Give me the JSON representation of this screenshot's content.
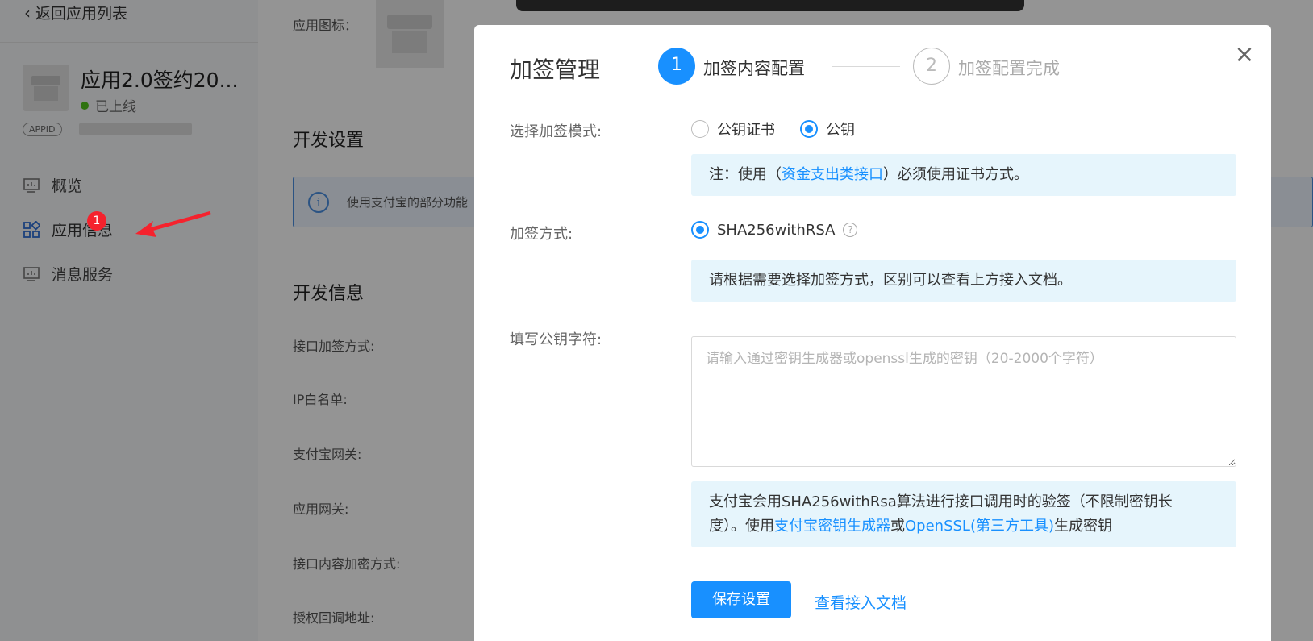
{
  "sidebar": {
    "back_label": "返回应用列表",
    "app_name": "应用2.0签约20...",
    "app_status": "已上线",
    "appid_tag": "APPID",
    "nav": [
      {
        "label": "概览",
        "icon": "monitor-chart-icon"
      },
      {
        "label": "应用信息",
        "icon": "grid-apps-icon"
      },
      {
        "label": "消息服务",
        "icon": "monitor-chart-icon"
      }
    ],
    "badge_count": "1"
  },
  "main": {
    "app_icon_label": "应用图标：",
    "dev_settings_title": "开发设置",
    "info_bar_text": "使用支付宝的部分功能",
    "dev_info_title": "开发信息",
    "fields": [
      "接口加签方式:",
      "IP白名单:",
      "支付宝网关:",
      "应用网关:",
      "接口内容加密方式:",
      "授权回调地址:"
    ]
  },
  "modal": {
    "title": "加签管理",
    "steps": [
      {
        "number": "1",
        "label": "加签内容配置"
      },
      {
        "number": "2",
        "label": "加签配置完成"
      }
    ],
    "close_symbol": "×",
    "mode_label": "选择加签模式:",
    "mode_options": [
      "公钥证书",
      "公钥"
    ],
    "mode_selected": "公钥",
    "mode_note_prefix": "注：使用（",
    "mode_note_link": "资金支出类接口",
    "mode_note_suffix": "）必须使用证书方式。",
    "method_label": "加签方式:",
    "method_option": "SHA256withRSA",
    "method_note": "请根据需要选择加签方式，区别可以查看上方接入文档。",
    "key_label": "填写公钥字符:",
    "key_placeholder": "请输入通过密钥生成器或openssl生成的密钥（20-2000个字符）",
    "tip_line1": "支付宝会用SHA256withRsa算法进行接口调用时的验签（不限制密钥长",
    "tip_line2_prefix": "度）。使用",
    "tip_link1": "支付宝密钥生成器",
    "tip_or": "或",
    "tip_link2": "OpenSSL(第三方工具)",
    "tip_suffix": "生成密钥",
    "save_button": "保存设置",
    "doc_link": "查看接入文档"
  },
  "colors": {
    "primary": "#1890ff",
    "note_bg": "#e6f5fc",
    "status_online": "#52c41a",
    "badge": "#f5222d",
    "arrow": "#f5222d"
  }
}
